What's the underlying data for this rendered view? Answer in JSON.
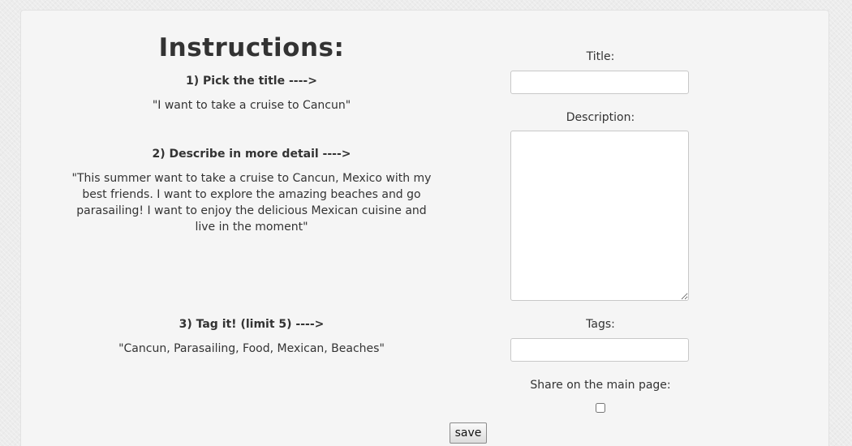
{
  "instructions": {
    "heading": "Instructions:",
    "step1": "1) Pick the title ---->",
    "example1": "\"I want to take a cruise to Cancun\"",
    "step2": "2) Describe in more detail ---->",
    "example2": "\"This summer want to take a cruise to Cancun, Mexico with my best friends. I want to explore the amazing beaches and go parasailing! I want to enjoy the delicious Mexican cuisine and live in the moment\"",
    "step3": "3) Tag it! (limit 5) ---->",
    "example3": "\"Cancun, Parasailing, Food, Mexican, Beaches\""
  },
  "form": {
    "title_label": "Title:",
    "title_value": "",
    "description_label": "Description:",
    "description_value": "",
    "tags_label": "Tags:",
    "tags_value": "",
    "share_label": "Share on the main page:",
    "share_checked": false,
    "save_label": "save"
  }
}
